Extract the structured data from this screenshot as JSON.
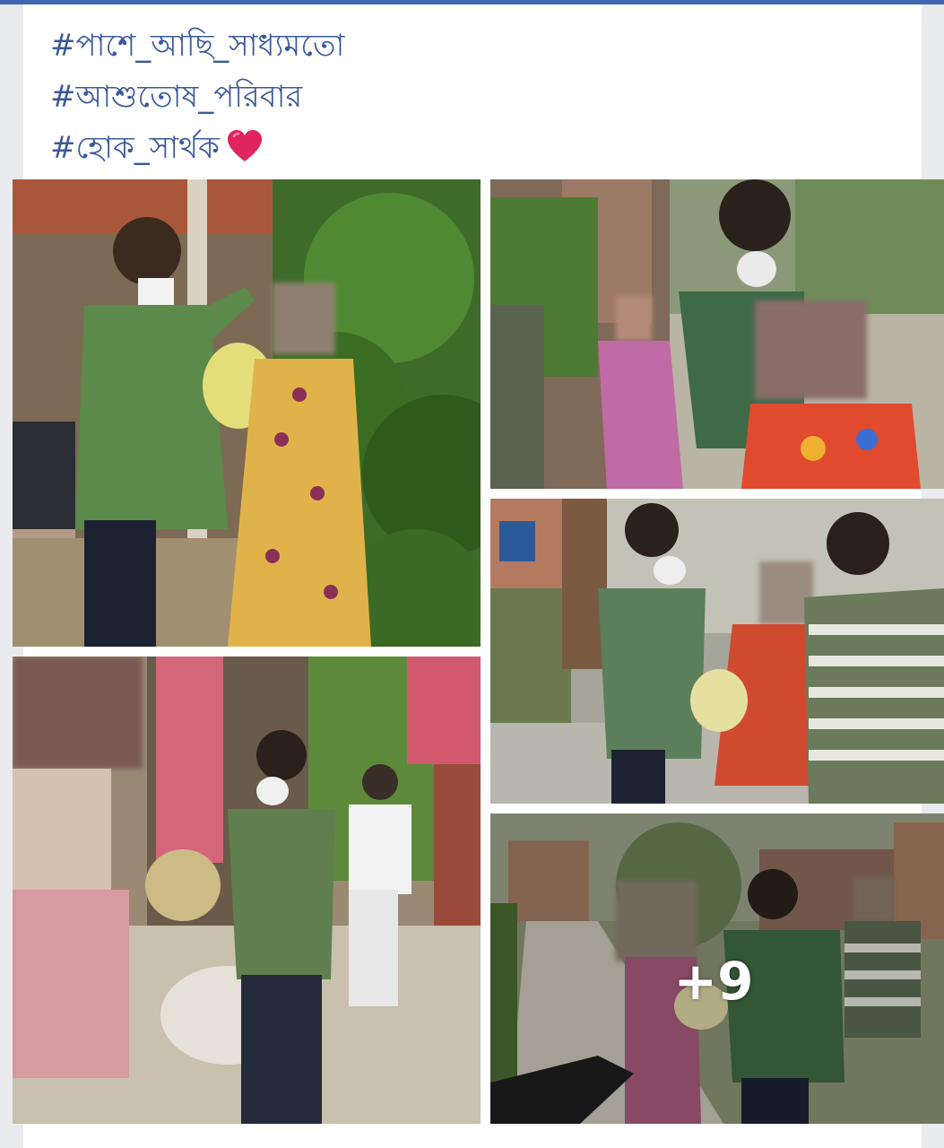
{
  "post": {
    "hashtags": [
      "#পাশে_আছি_সাধ্যমতো",
      "#আশুতোষ_পরিবার",
      "#হোক_সার্থক"
    ],
    "heart_icon": "red-heart-emoji"
  },
  "photos": [
    {
      "id": "photo-1",
      "description_icon": "relief-distribution-photo"
    },
    {
      "id": "photo-2",
      "description_icon": "relief-distribution-photo"
    },
    {
      "id": "photo-3",
      "description_icon": "relief-distribution-photo"
    },
    {
      "id": "photo-4",
      "description_icon": "relief-distribution-photo"
    },
    {
      "id": "photo-5",
      "description_icon": "relief-distribution-photo"
    }
  ],
  "more_photos": {
    "label": "+9"
  },
  "colors": {
    "accent": "#3b5998",
    "topbar": "#4267b2",
    "heart": "#e0245e"
  }
}
